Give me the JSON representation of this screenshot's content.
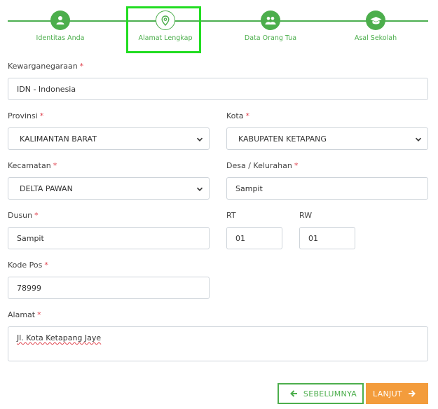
{
  "stepper": {
    "steps": [
      {
        "label": "Identitas Anda",
        "icon": "user-icon"
      },
      {
        "label": "Alamat Lengkap",
        "icon": "map-marker-icon"
      },
      {
        "label": "Data Orang Tua",
        "icon": "users-icon"
      },
      {
        "label": "Asal Sekolah",
        "icon": "graduation-cap-icon"
      }
    ],
    "active_index": 1
  },
  "form": {
    "kewarganegaraan": {
      "label": "Kewarganegaraan",
      "required": "*",
      "value": "IDN - Indonesia"
    },
    "provinsi": {
      "label": "Provinsi",
      "required": "*",
      "value": "KALIMANTAN BARAT"
    },
    "kota": {
      "label": "Kota",
      "required": "*",
      "value": "KABUPATEN KETAPANG"
    },
    "kecamatan": {
      "label": "Kecamatan",
      "required": "*",
      "value": "DELTA PAWAN"
    },
    "desa": {
      "label": "Desa / Kelurahan",
      "required": "*",
      "value": "Sampit"
    },
    "dusun": {
      "label": "Dusun",
      "required": "*",
      "value": "Sampit"
    },
    "rt": {
      "label": "RT",
      "value": "01"
    },
    "rw": {
      "label": "RW",
      "value": "01"
    },
    "kode_pos": {
      "label": "Kode Pos",
      "required": "*",
      "value": "78999"
    },
    "alamat": {
      "label": "Alamat",
      "required": "*",
      "value": "Jl. Kota Ketapang Jaye"
    }
  },
  "buttons": {
    "prev_label": "SEBELUMNYA",
    "next_label": "LANJUT"
  },
  "colors": {
    "accent_green": "#4cae4c",
    "highlight_green": "#22dd22",
    "orange": "#f39c3c",
    "required_red": "#e0424d"
  }
}
